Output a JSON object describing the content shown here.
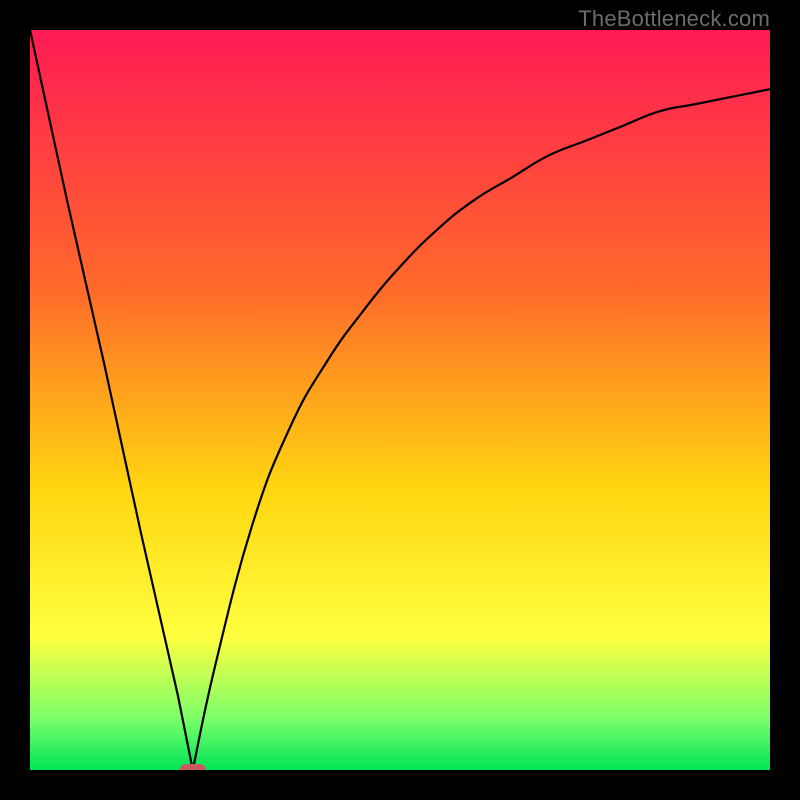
{
  "attribution": "TheBottleneck.com",
  "colors": {
    "frame": "#000000",
    "grad_top": "#ff1a54",
    "grad_mid1": "#ff6a2a",
    "grad_mid2": "#ffd610",
    "grad_yellow": "#ffff40",
    "grad_green_fade": "#7cff6a",
    "grad_green": "#00e556",
    "curve": "#000000",
    "marker_fill": "#c95b5f",
    "marker_stroke": "#b94a4e"
  },
  "chart_data": {
    "type": "line",
    "title": "",
    "xlabel": "",
    "ylabel": "",
    "xlim": [
      0,
      100
    ],
    "ylim": [
      0,
      100
    ],
    "grid": false,
    "legend": false,
    "series": [
      {
        "name": "bottleneck-curve",
        "x": [
          0,
          5,
          10,
          15,
          20,
          22,
          25,
          30,
          35,
          40,
          45,
          50,
          55,
          60,
          65,
          70,
          75,
          80,
          85,
          90,
          95,
          100
        ],
        "values": [
          100,
          77,
          55,
          32,
          10,
          0,
          14,
          33,
          46,
          55,
          62,
          68,
          73,
          77,
          80,
          83,
          85,
          87,
          89,
          90,
          91,
          92
        ]
      }
    ],
    "annotations": [
      {
        "name": "minimum-marker",
        "x": 22,
        "y": 0,
        "shape": "pill"
      }
    ]
  }
}
